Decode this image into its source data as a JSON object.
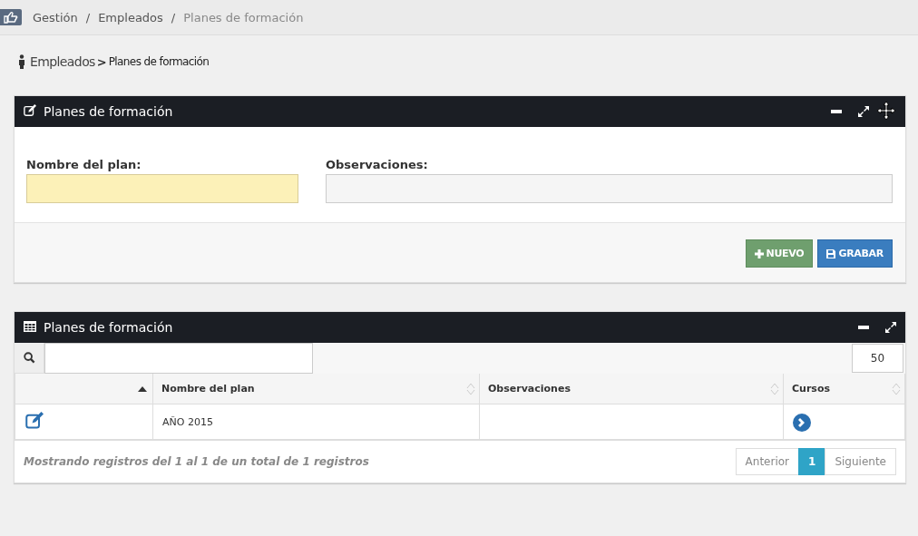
{
  "breadcrumb": {
    "separator": "/",
    "items": [
      {
        "label": "Gestión"
      },
      {
        "label": "Empleados"
      },
      {
        "label": "Planes de formación"
      }
    ]
  },
  "page_path": {
    "parent": "Empleados",
    "separator": ">",
    "current": "Planes de formación"
  },
  "form_panel": {
    "title": "Planes de formación",
    "fields": [
      {
        "label": "Nombre del plan:",
        "required": true
      },
      {
        "label": "Observaciones:",
        "required": false
      }
    ],
    "buttons": [
      {
        "kind": "new",
        "label": "NUEVO"
      },
      {
        "kind": "save",
        "label": "GRABAR"
      }
    ]
  },
  "table_panel": {
    "title": "Planes de formación",
    "page_length": "50",
    "columns": [
      {
        "sorted": true
      },
      {
        "label": "Nombre del plan",
        "sorted": false
      },
      {
        "label": "Observaciones",
        "sorted": false
      },
      {
        "label": "Cursos",
        "sorted": false
      }
    ],
    "rows": [
      {
        "nombre_del_plan": "AÑO 2015"
      }
    ],
    "info": "Mostrando registros del 1 al 1 de un total de 1 registros",
    "pagination": [
      {
        "label": "Anterior",
        "selected": false
      },
      {
        "label": "1",
        "selected": true
      },
      {
        "label": "Siguiente",
        "selected": false
      }
    ]
  }
}
